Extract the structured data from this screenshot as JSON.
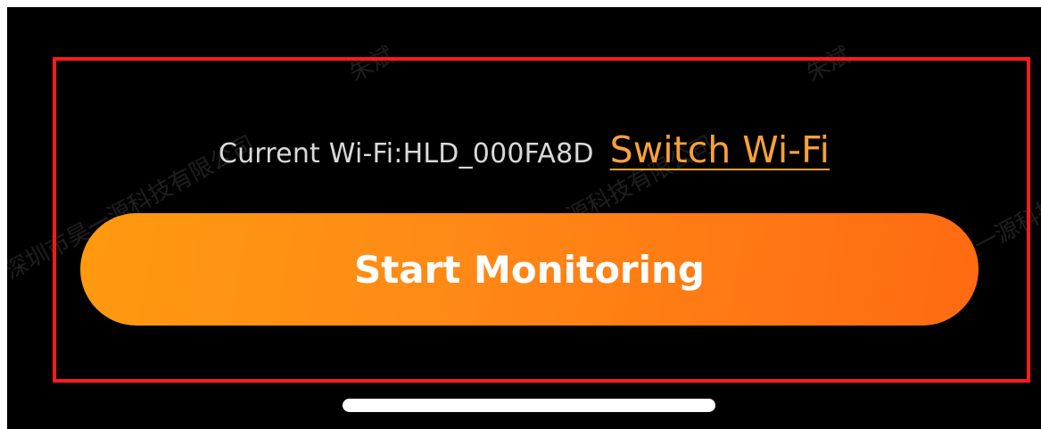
{
  "wifi": {
    "current_label": "Current Wi-Fi:HLD_000FA8D",
    "switch_label": "Switch Wi-Fi"
  },
  "actions": {
    "start_label": "Start Monitoring"
  },
  "watermarks": [
    "朱斌",
    "朱斌",
    "深圳市昊一源科技有限公司",
    "深圳市昊一源科技有限公司",
    "深圳市昊一源科技"
  ],
  "colors": {
    "background": "#000000",
    "accent_orange": "#ff8a16",
    "link_orange": "#f7a13a",
    "highlight_red": "#ff1a1a"
  }
}
